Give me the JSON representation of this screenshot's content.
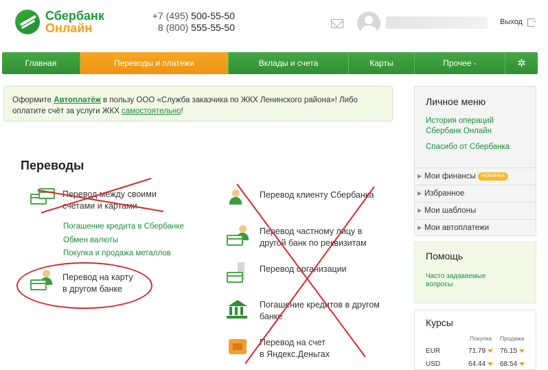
{
  "brand": {
    "line1": "Сбербанк",
    "line2": "Онлайн",
    "green": "#1a9b3a",
    "orange": "#f0a21c"
  },
  "header": {
    "phone1_prefix": "+7 (495) ",
    "phone1_num": "500-55-50",
    "phone2_prefix": "8 (800) ",
    "phone2_num": "555-55-50",
    "logout_label": "Выход"
  },
  "nav": {
    "items": [
      "Главная",
      "Переводы и платежи",
      "Вклады и счета",
      "Карты",
      "Прочее -"
    ],
    "active": "Переводы и платежи",
    "active_color": "#f6a623"
  },
  "notice": {
    "text1": "Оформите ",
    "link1": "Автоплатёж",
    "text2": " в пользу ООО «Служба заказчика по ЖКХ Ленинского района»! Либо оплатите счёт за услуги ЖКХ ",
    "link2": "самостоятельно",
    "text3": "!"
  },
  "transfers": {
    "title": "Переводы",
    "own_accounts": {
      "line1": "Перевод между своими",
      "line2": "счетами и картами"
    },
    "sublinks": [
      "Погашение кредита в Сбербанке",
      "Обмен валюты",
      "Покупка и продажа металлов"
    ],
    "card_other_bank": {
      "line1": "Перевод на карту",
      "line2": "в другом банке"
    },
    "client": "Перевод клиенту Сбербанка",
    "private_person": {
      "line1": "Перевод частному лицу в",
      "line2": "другой банк по реквизитам"
    },
    "organization": "Перевод организации",
    "loan_other": {
      "line1": "Погашение кредитов в другом",
      "line2": "банке"
    },
    "yandex": {
      "line1": "Перевод на счет",
      "line2": "в Яндекс.Деньгах"
    }
  },
  "personal_menu": {
    "title": "Личное меню",
    "links": [
      "История операций Сбербанк Онлайн",
      "Спасибо от Сбербанка"
    ],
    "history_l1": "История операций",
    "history_l2": "Сбербанк Онлайн",
    "rows": [
      "Мои финансы",
      "Избранное",
      "Мои шаблоны",
      "Мои автоплатежи"
    ],
    "new_badge": "НОВИНКА"
  },
  "help": {
    "title": "Помощь",
    "faq_l1": "Часто задаваемые",
    "faq_l2": "вопросы"
  },
  "rates": {
    "title": "Курсы",
    "buy_header": "Покупка",
    "sell_header": "Продажа",
    "rows": [
      {
        "currency": "EUR",
        "buy": "71.79",
        "sell": "76.15"
      },
      {
        "currency": "USD",
        "buy": "64.44",
        "sell": "68.54"
      }
    ]
  },
  "annotations": {
    "cross_color": "#d42b2b"
  }
}
